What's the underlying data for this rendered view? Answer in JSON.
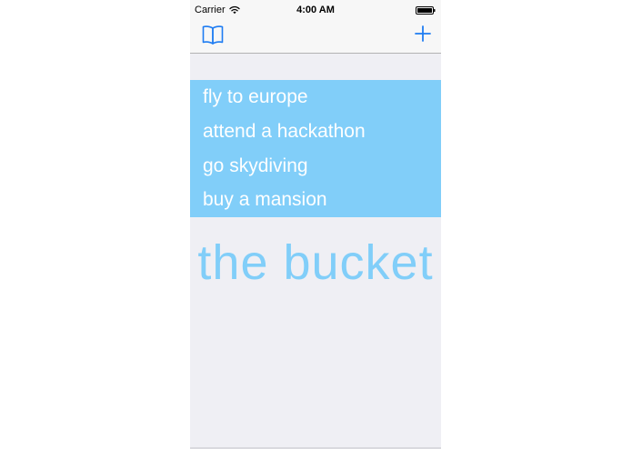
{
  "status_bar": {
    "carrier": "Carrier",
    "time": "4:00 AM",
    "wifi_icon": "wifi-icon",
    "battery_icon": "battery-icon"
  },
  "nav_bar": {
    "left_icon": "book-icon",
    "right_icon": "plus-icon"
  },
  "bucket_list": {
    "background_color": "#81cef9",
    "items": [
      {
        "label": "fly to europe"
      },
      {
        "label": "attend a hackathon"
      },
      {
        "label": "go skydiving"
      },
      {
        "label": "buy a mansion"
      }
    ]
  },
  "app_title": "the bucket",
  "colors": {
    "accent": "#1e7cf2",
    "list_background": "#81cef9",
    "title_text": "#81cef9",
    "screen_background": "#efeff4"
  }
}
